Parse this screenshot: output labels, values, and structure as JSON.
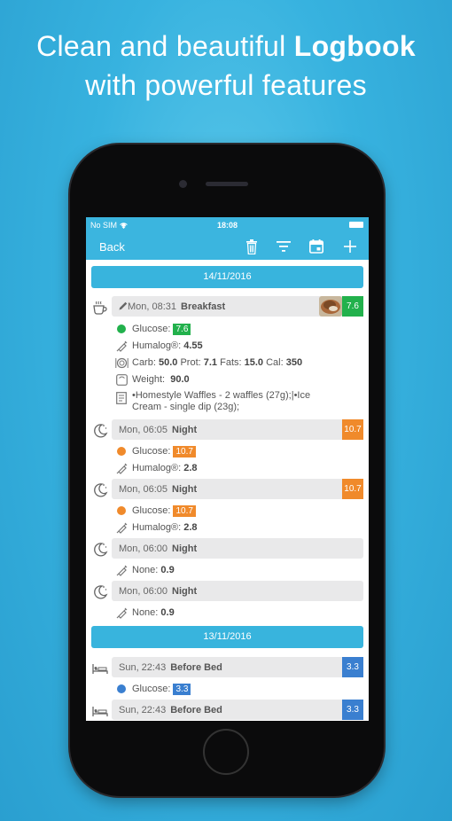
{
  "headline": {
    "line1_prefix": "Clean and beautiful",
    "line1_bold": "Logbook",
    "line2": "with powerful features"
  },
  "status": {
    "carrier": "No SIM",
    "time": "18:08"
  },
  "nav": {
    "back": "Back"
  },
  "dates": [
    "14/11/2016",
    "13/11/2016"
  ],
  "colors": {
    "green": "#22b14c",
    "orange": "#f08a2b",
    "blue": "#3a7fd0",
    "accent": "#38b4dd"
  },
  "entries": [
    {
      "icon": "coffee-icon",
      "time": "Mon, 08:31",
      "meal": "Breakfast",
      "badge": "7.6",
      "badge_color": "green",
      "glucose_label": "Glucose:",
      "glucose": "7.6",
      "insulin_label": "Humalog®:",
      "insulin": "4.55",
      "carb_label": "Carb:",
      "carb": "50.0",
      "prot_label": "Prot:",
      "prot": "7.1",
      "fats_label": "Fats:",
      "fats": "15.0",
      "cal_label": "Cal:",
      "cal": "350",
      "weight_label": "Weight:",
      "weight": "90.0",
      "note_line1": "•Homestyle Waffles - 2 waffles (27g);|•Ice",
      "note_line2": "Cream - single dip (23g);"
    },
    {
      "icon": "moon-icon",
      "time": "Mon, 06:05",
      "meal": "Night",
      "badge": "10.7",
      "badge_color": "orange",
      "glucose_label": "Glucose:",
      "glucose": "10.7",
      "insulin_label": "Humalog®:",
      "insulin": "2.8"
    },
    {
      "icon": "moon-icon",
      "time": "Mon, 06:05",
      "meal": "Night",
      "badge": "10.7",
      "badge_color": "orange",
      "glucose_label": "Glucose:",
      "glucose": "10.7",
      "insulin_label": "Humalog®:",
      "insulin": "2.8"
    },
    {
      "icon": "moon-icon",
      "time": "Mon, 06:00",
      "meal": "Night",
      "none_label": "None:",
      "none": "0.9"
    },
    {
      "icon": "moon-icon",
      "time": "Mon, 06:00",
      "meal": "Night",
      "none_label": "None:",
      "none": "0.9"
    },
    {
      "icon": "bed-icon",
      "time": "Sun, 22:43",
      "meal": "Before Bed",
      "badge": "3.3",
      "badge_color": "blue",
      "glucose_label": "Glucose:",
      "glucose": "3.3"
    },
    {
      "icon": "bed-icon",
      "time": "Sun, 22:43",
      "meal": "Before Bed",
      "badge": "3.3",
      "badge_color": "blue"
    }
  ]
}
